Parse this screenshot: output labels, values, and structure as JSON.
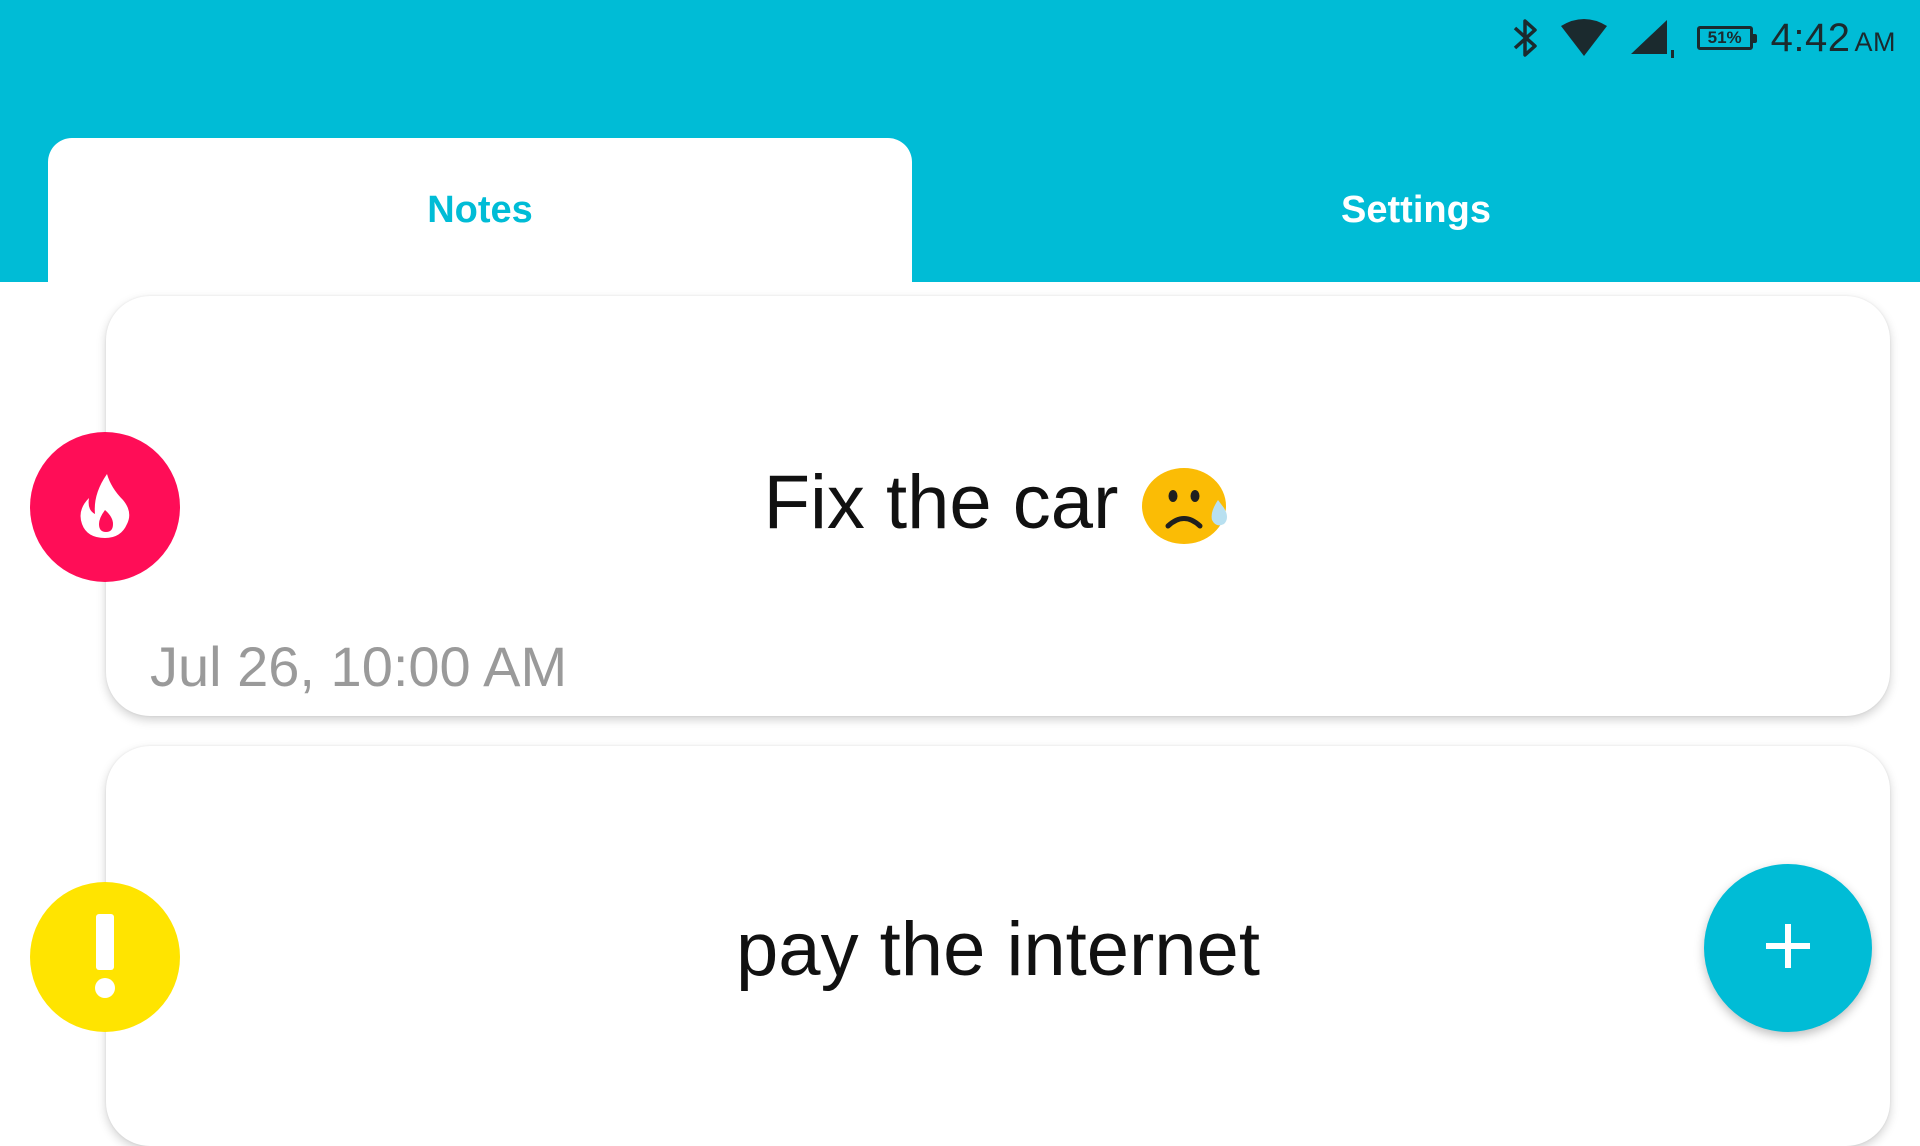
{
  "status_bar": {
    "battery": "51%",
    "time": "4:42",
    "ampm": "AM",
    "icons": [
      "bluetooth-icon",
      "wifi-icon",
      "cell-signal-icon",
      "battery-icon"
    ]
  },
  "tabs": [
    {
      "label": "Notes",
      "selected": true
    },
    {
      "label": "Settings",
      "selected": false
    }
  ],
  "notes": [
    {
      "title": "Fix the car",
      "emoji": "sad-tear-face",
      "date": "Jul 26, 10:00 AM",
      "priority_icon": "flame-icon",
      "priority_color": "#ff0d57"
    },
    {
      "title": "pay the internet",
      "priority_icon": "exclamation-icon",
      "priority_color": "#ffe400"
    }
  ],
  "fab": {
    "icon": "plus-icon"
  },
  "colors": {
    "primary": "#00bcd6",
    "hot": "#ff0d57",
    "warning": "#ffe400"
  }
}
